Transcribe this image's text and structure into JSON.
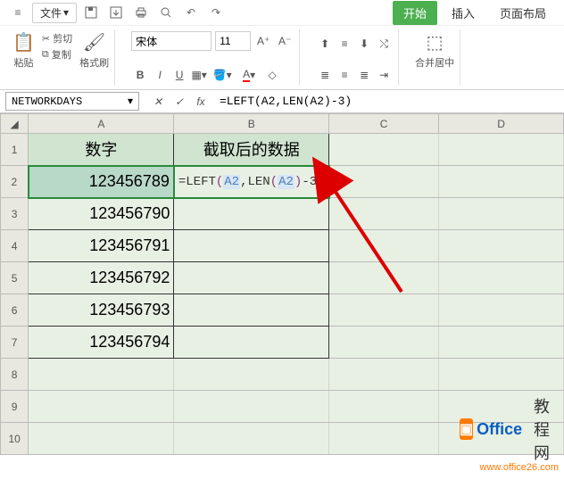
{
  "menu": {
    "file_label": "文件"
  },
  "tabs": {
    "start": "开始",
    "insert": "插入",
    "layout": "页面布局"
  },
  "toolbar": {
    "paste": "粘贴",
    "cut": "剪切",
    "copy": "复制",
    "format_painter": "格式刷",
    "font_name": "宋体",
    "font_size": "11",
    "merge_center": "合并居中"
  },
  "formula_bar": {
    "name_box": "NETWORKDAYS",
    "formula": "=LEFT(A2,LEN(A2)-3)"
  },
  "columns": [
    "A",
    "B",
    "C",
    "D"
  ],
  "rows": [
    "1",
    "2",
    "3",
    "4",
    "5",
    "6",
    "7",
    "8",
    "9",
    "10"
  ],
  "headers": {
    "col_a": "数字",
    "col_b": "截取后的数据"
  },
  "cells": {
    "a2": "123456789",
    "a3": "123456790",
    "a4": "123456791",
    "a5": "123456792",
    "a6": "123456793",
    "a7": "123456794",
    "b2_formula_prefix": "=LEFT",
    "b2_ref1": "A2",
    "b2_mid": ",LEN",
    "b2_ref2": "A2",
    "b2_suffix": "-3"
  },
  "watermark": {
    "brand1": "Office",
    "brand2": "教程网",
    "url": "www.office26.com"
  }
}
